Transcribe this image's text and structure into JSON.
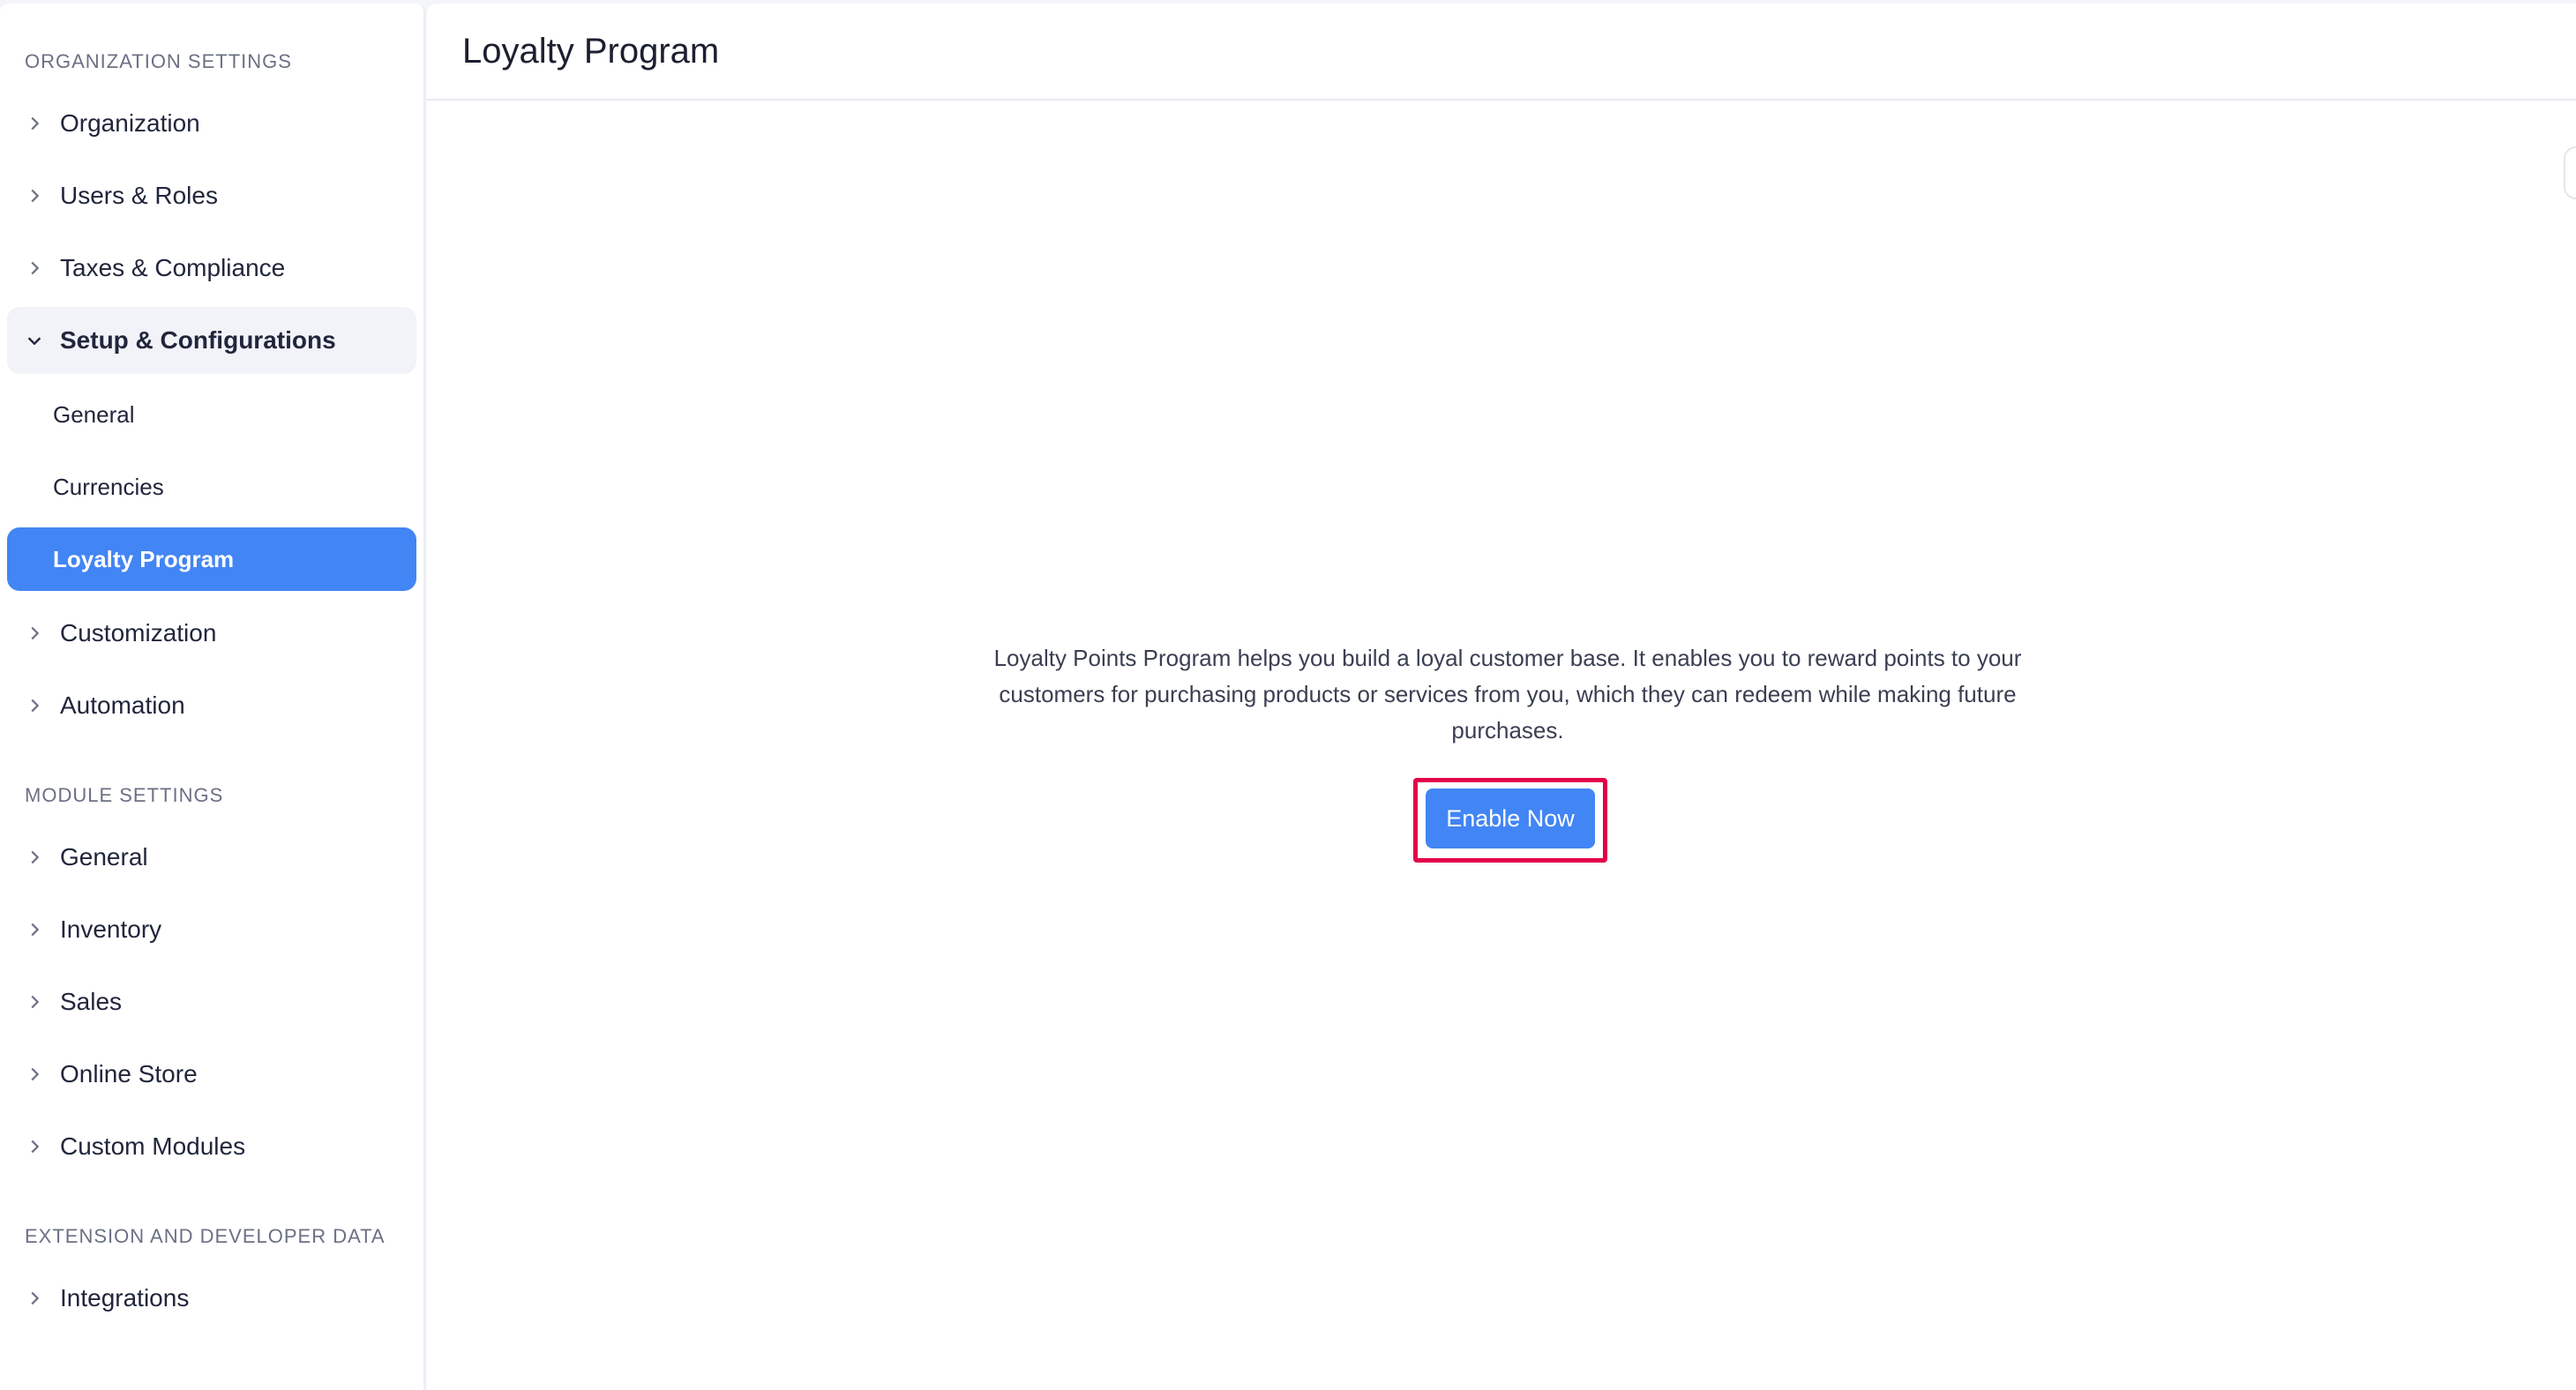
{
  "sidebar": {
    "org_section": "ORGANIZATION SETTINGS",
    "org_items": [
      "Organization",
      "Users & Roles",
      "Taxes & Compliance"
    ],
    "setup": {
      "label": "Setup & Configurations",
      "subitems": [
        "General",
        "Currencies",
        "Loyalty Program"
      ]
    },
    "org_items_after": [
      "Customization",
      "Automation"
    ],
    "module_section": "MODULE SETTINGS",
    "module_items": [
      "General",
      "Inventory",
      "Sales",
      "Online Store",
      "Custom Modules"
    ],
    "ext_section": "EXTENSION AND DEVELOPER DATA",
    "ext_items": [
      "Integrations"
    ]
  },
  "main": {
    "title": "Loyalty Program",
    "description": "Loyalty Points Program helps you build a loyal customer base. It enables you to reward points to your customers for purchasing products or services from you, which they can redeem while making future purchases.",
    "enable_button": "Enable Now"
  },
  "colors": {
    "accent": "#4285f4",
    "highlight": "#e3004a"
  }
}
